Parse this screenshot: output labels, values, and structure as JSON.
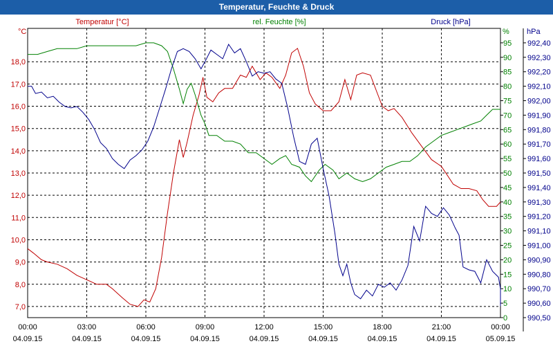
{
  "window": {
    "title": "Temperatur, Feuchte & Druck"
  },
  "chart_data": {
    "type": "line",
    "title": "Temperatur, Feuchte & Druck",
    "grid": true,
    "x": {
      "range_hours": [
        0,
        24
      ],
      "ticks": [
        {
          "h": 0,
          "time": "00:00",
          "date": "04.09.15"
        },
        {
          "h": 3,
          "time": "03:00",
          "date": "04.09.15"
        },
        {
          "h": 6,
          "time": "06:00",
          "date": "04.09.15"
        },
        {
          "h": 9,
          "time": "09:00",
          "date": "04.09.15"
        },
        {
          "h": 12,
          "time": "12:00",
          "date": "04.09.15"
        },
        {
          "h": 15,
          "time": "15:00",
          "date": "04.09.15"
        },
        {
          "h": 18,
          "time": "18:00",
          "date": "04.09.15"
        },
        {
          "h": 21,
          "time": "21:00",
          "date": "04.09.15"
        },
        {
          "h": 24,
          "time": "00:00",
          "date": "05.09.15"
        }
      ]
    },
    "axes": {
      "temp": {
        "label": "Temperatur [°C]",
        "unit": "°C",
        "color": "#c00000",
        "min": 6.5,
        "max": 19.5,
        "ticks": [
          "7,0",
          "8,0",
          "9,0",
          "10,0",
          "11,0",
          "12,0",
          "13,0",
          "14,0",
          "15,0",
          "16,0",
          "17,0",
          "18,0"
        ]
      },
      "hum": {
        "label": "rel. Feuchte [%]",
        "unit": "%",
        "color": "#008000",
        "min": 0,
        "max": 100,
        "ticks": [
          "0",
          "5",
          "10",
          "15",
          "20",
          "25",
          "30",
          "35",
          "40",
          "45",
          "50",
          "55",
          "60",
          "65",
          "70",
          "75",
          "80",
          "85",
          "90",
          "95"
        ]
      },
      "press": {
        "label": "Druck [hPa]",
        "unit": "hPa",
        "color": "#00008b",
        "min": 990.5,
        "max": 992.5,
        "ticks": [
          "990,50",
          "990,60",
          "990,70",
          "990,80",
          "990,90",
          "991,00",
          "991,10",
          "991,20",
          "991,30",
          "991,40",
          "991,50",
          "991,60",
          "991,70",
          "991,80",
          "991,90",
          "992,00",
          "992,10",
          "992,20",
          "992,30",
          "992,40"
        ]
      }
    },
    "series": [
      {
        "name": "Temperatur [°C]",
        "axis": "temp",
        "color": "#c00000",
        "points": [
          [
            0,
            9.6
          ],
          [
            0.3,
            9.4
          ],
          [
            0.7,
            9.1
          ],
          [
            1.0,
            9.0
          ],
          [
            1.5,
            8.9
          ],
          [
            2.0,
            8.7
          ],
          [
            2.5,
            8.4
          ],
          [
            3.0,
            8.2
          ],
          [
            3.5,
            8.0
          ],
          [
            4.0,
            8.0
          ],
          [
            4.3,
            7.8
          ],
          [
            4.8,
            7.4
          ],
          [
            5.2,
            7.1
          ],
          [
            5.6,
            7.0
          ],
          [
            5.9,
            7.3
          ],
          [
            6.2,
            7.2
          ],
          [
            6.5,
            7.8
          ],
          [
            6.8,
            9.2
          ],
          [
            7.1,
            11.2
          ],
          [
            7.4,
            13.0
          ],
          [
            7.7,
            14.5
          ],
          [
            7.9,
            13.7
          ],
          [
            8.1,
            14.4
          ],
          [
            8.4,
            15.6
          ],
          [
            8.7,
            16.5
          ],
          [
            8.9,
            17.3
          ],
          [
            9.1,
            16.4
          ],
          [
            9.4,
            16.2
          ],
          [
            9.7,
            16.6
          ],
          [
            10.0,
            16.8
          ],
          [
            10.4,
            16.8
          ],
          [
            10.8,
            17.4
          ],
          [
            11.1,
            17.3
          ],
          [
            11.4,
            17.8
          ],
          [
            11.8,
            17.2
          ],
          [
            12.1,
            17.5
          ],
          [
            12.4,
            17.3
          ],
          [
            12.8,
            16.8
          ],
          [
            13.1,
            17.4
          ],
          [
            13.4,
            18.4
          ],
          [
            13.7,
            18.6
          ],
          [
            14.0,
            17.8
          ],
          [
            14.3,
            16.6
          ],
          [
            14.6,
            16.1
          ],
          [
            15.0,
            15.8
          ],
          [
            15.4,
            15.8
          ],
          [
            15.8,
            16.2
          ],
          [
            16.1,
            17.2
          ],
          [
            16.4,
            16.3
          ],
          [
            16.7,
            17.4
          ],
          [
            17.0,
            17.5
          ],
          [
            17.4,
            17.4
          ],
          [
            17.7,
            16.7
          ],
          [
            18.0,
            16.0
          ],
          [
            18.3,
            15.8
          ],
          [
            18.6,
            15.9
          ],
          [
            19.0,
            15.5
          ],
          [
            19.5,
            14.8
          ],
          [
            20.0,
            14.2
          ],
          [
            20.5,
            13.6
          ],
          [
            21.0,
            13.3
          ],
          [
            21.3,
            12.9
          ],
          [
            21.6,
            12.5
          ],
          [
            22.0,
            12.3
          ],
          [
            22.4,
            12.3
          ],
          [
            22.8,
            12.2
          ],
          [
            23.1,
            11.8
          ],
          [
            23.4,
            11.5
          ],
          [
            23.8,
            11.5
          ],
          [
            24.0,
            11.7
          ]
        ]
      },
      {
        "name": "rel. Feuchte [%]",
        "axis": "hum",
        "color": "#008000",
        "points": [
          [
            0,
            91
          ],
          [
            0.5,
            91
          ],
          [
            1.0,
            92
          ],
          [
            1.5,
            93
          ],
          [
            2.0,
            93
          ],
          [
            2.5,
            93
          ],
          [
            3.0,
            94
          ],
          [
            3.5,
            94
          ],
          [
            4.0,
            94
          ],
          [
            4.5,
            94
          ],
          [
            5.0,
            94
          ],
          [
            5.5,
            94
          ],
          [
            6.0,
            95
          ],
          [
            6.4,
            95
          ],
          [
            6.8,
            94
          ],
          [
            7.1,
            92
          ],
          [
            7.4,
            86
          ],
          [
            7.7,
            79
          ],
          [
            7.9,
            74
          ],
          [
            8.1,
            79
          ],
          [
            8.3,
            81
          ],
          [
            8.5,
            77
          ],
          [
            8.8,
            70
          ],
          [
            9.0,
            67
          ],
          [
            9.2,
            63
          ],
          [
            9.6,
            63
          ],
          [
            10.0,
            61
          ],
          [
            10.4,
            61
          ],
          [
            10.8,
            60
          ],
          [
            11.2,
            57
          ],
          [
            11.6,
            57
          ],
          [
            12.0,
            55
          ],
          [
            12.4,
            53
          ],
          [
            12.8,
            55
          ],
          [
            13.1,
            56
          ],
          [
            13.4,
            53
          ],
          [
            13.8,
            52
          ],
          [
            14.1,
            49
          ],
          [
            14.4,
            47
          ],
          [
            14.8,
            51
          ],
          [
            15.1,
            53
          ],
          [
            15.5,
            51
          ],
          [
            15.8,
            48
          ],
          [
            16.2,
            50
          ],
          [
            16.6,
            48
          ],
          [
            17.0,
            47
          ],
          [
            17.4,
            48
          ],
          [
            17.8,
            50
          ],
          [
            18.2,
            52
          ],
          [
            18.6,
            53
          ],
          [
            19.0,
            54
          ],
          [
            19.4,
            54
          ],
          [
            19.8,
            56
          ],
          [
            20.2,
            59
          ],
          [
            20.6,
            61
          ],
          [
            21.0,
            63
          ],
          [
            21.4,
            64
          ],
          [
            21.8,
            65
          ],
          [
            22.2,
            66
          ],
          [
            22.6,
            67
          ],
          [
            23.0,
            68
          ],
          [
            23.3,
            70
          ],
          [
            23.6,
            72
          ],
          [
            24.0,
            72
          ]
        ]
      },
      {
        "name": "Druck [hPa]",
        "axis": "press",
        "color": "#00008b",
        "points": [
          [
            0,
            992.1
          ],
          [
            0.2,
            992.1
          ],
          [
            0.4,
            992.05
          ],
          [
            0.7,
            992.06
          ],
          [
            1.0,
            992.02
          ],
          [
            1.3,
            992.03
          ],
          [
            1.6,
            991.99
          ],
          [
            1.9,
            991.96
          ],
          [
            2.2,
            991.95
          ],
          [
            2.5,
            991.96
          ],
          [
            2.8,
            991.92
          ],
          [
            3.1,
            991.87
          ],
          [
            3.4,
            991.8
          ],
          [
            3.7,
            991.71
          ],
          [
            4.0,
            991.67
          ],
          [
            4.3,
            991.6
          ],
          [
            4.6,
            991.56
          ],
          [
            4.9,
            991.53
          ],
          [
            5.2,
            991.59
          ],
          [
            5.5,
            991.62
          ],
          [
            5.8,
            991.66
          ],
          [
            6.1,
            991.72
          ],
          [
            6.4,
            991.82
          ],
          [
            6.7,
            991.95
          ],
          [
            7.0,
            992.08
          ],
          [
            7.3,
            992.22
          ],
          [
            7.6,
            992.34
          ],
          [
            7.9,
            992.36
          ],
          [
            8.2,
            992.34
          ],
          [
            8.5,
            992.29
          ],
          [
            8.8,
            992.22
          ],
          [
            9.0,
            992.27
          ],
          [
            9.3,
            992.35
          ],
          [
            9.6,
            992.32
          ],
          [
            9.9,
            992.29
          ],
          [
            10.2,
            992.39
          ],
          [
            10.5,
            992.33
          ],
          [
            10.8,
            992.36
          ],
          [
            11.1,
            992.27
          ],
          [
            11.4,
            992.17
          ],
          [
            11.7,
            992.2
          ],
          [
            12.0,
            992.19
          ],
          [
            12.3,
            992.2
          ],
          [
            12.6,
            992.15
          ],
          [
            12.9,
            992.12
          ],
          [
            13.2,
            991.95
          ],
          [
            13.5,
            991.75
          ],
          [
            13.8,
            991.58
          ],
          [
            14.1,
            991.56
          ],
          [
            14.4,
            991.7
          ],
          [
            14.7,
            991.74
          ],
          [
            15.0,
            991.53
          ],
          [
            15.3,
            991.34
          ],
          [
            15.6,
            991.08
          ],
          [
            15.8,
            990.87
          ],
          [
            16.0,
            990.79
          ],
          [
            16.2,
            990.87
          ],
          [
            16.4,
            990.74
          ],
          [
            16.6,
            990.66
          ],
          [
            16.9,
            990.63
          ],
          [
            17.2,
            990.69
          ],
          [
            17.5,
            990.65
          ],
          [
            17.8,
            990.73
          ],
          [
            18.1,
            990.71
          ],
          [
            18.4,
            990.74
          ],
          [
            18.7,
            990.69
          ],
          [
            19.0,
            990.76
          ],
          [
            19.3,
            990.86
          ],
          [
            19.6,
            991.13
          ],
          [
            19.9,
            991.03
          ],
          [
            20.2,
            991.27
          ],
          [
            20.5,
            991.22
          ],
          [
            20.8,
            991.2
          ],
          [
            21.1,
            991.26
          ],
          [
            21.4,
            991.21
          ],
          [
            21.7,
            991.12
          ],
          [
            21.9,
            991.07
          ],
          [
            22.1,
            990.85
          ],
          [
            22.4,
            990.83
          ],
          [
            22.7,
            990.82
          ],
          [
            23.0,
            990.74
          ],
          [
            23.3,
            990.9
          ],
          [
            23.6,
            990.82
          ],
          [
            23.9,
            990.78
          ],
          [
            24.0,
            990.7
          ],
          [
            24.2,
            990.58
          ]
        ]
      }
    ]
  }
}
